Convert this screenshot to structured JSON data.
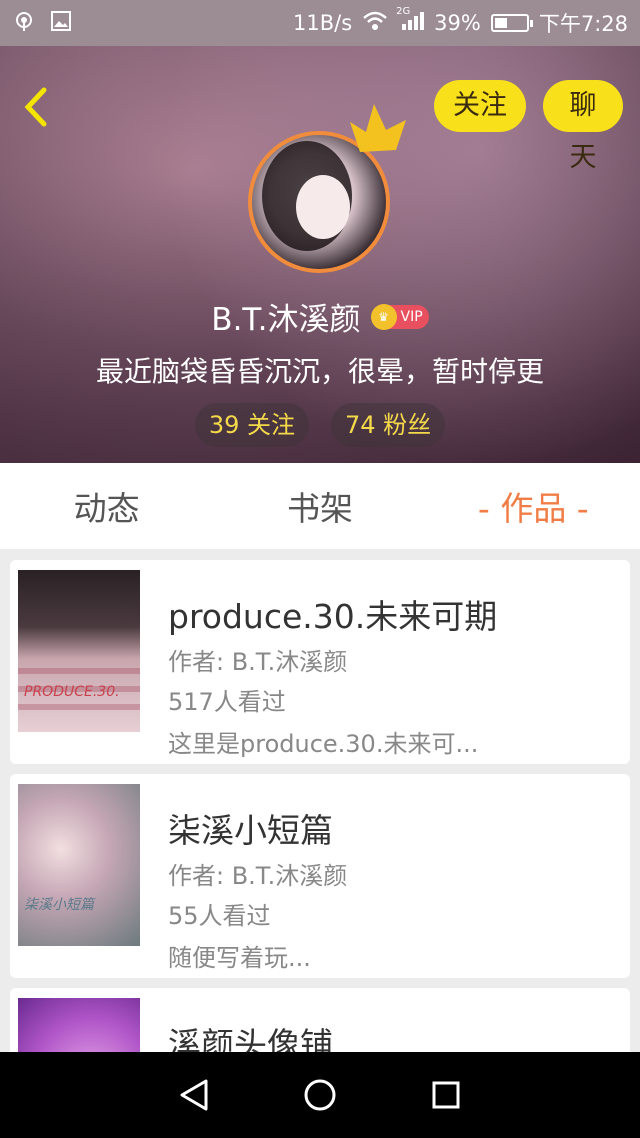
{
  "status_bar": {
    "network_speed": "11B/s",
    "signal_label": "2G",
    "battery_percent": "39%",
    "battery_level": 0.39,
    "time": "下午7:28"
  },
  "header": {
    "back_icon": "back-chevron-icon",
    "follow_label": "关注",
    "chat_label": "聊天",
    "username": "B.T.沐溪颜",
    "vip_label": "VIP",
    "bio": "最近脑袋昏昏沉沉，很晕，暂时停更",
    "following": "39 关注",
    "followers": "74 粉丝",
    "accent_color": "#f8e11a"
  },
  "tabs": [
    {
      "label": "动态",
      "active": false
    },
    {
      "label": "书架",
      "active": false
    },
    {
      "label": "- 作品 -",
      "active": true
    }
  ],
  "works": [
    {
      "title": "produce.30.未来可期",
      "author": "作者: B.T.沐溪颜",
      "views": "517人看过",
      "description": "这里是produce.30.未来可...",
      "cover_caption": "PRODUCE.30."
    },
    {
      "title": "柒溪小短篇",
      "author": "作者: B.T.沐溪颜",
      "views": "55人看过",
      "description": "随便写着玩...",
      "cover_caption": "柒溪小短篇"
    },
    {
      "title": "溪颜头像铺",
      "author": "",
      "views": "",
      "description": "",
      "cover_caption": ""
    }
  ],
  "nav_bar": {
    "back_icon": "nav-back-triangle-icon",
    "home_icon": "nav-home-circle-icon",
    "recents_icon": "nav-recents-square-icon"
  }
}
